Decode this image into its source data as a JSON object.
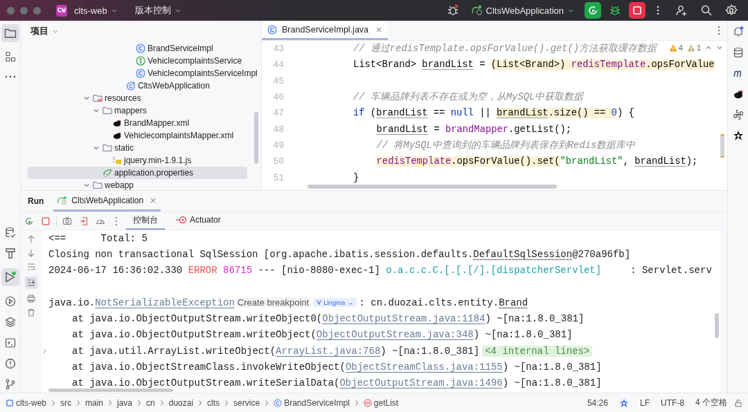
{
  "title_bar": {
    "badge": "CW",
    "project": "clts-web",
    "vcs": "版本控制",
    "run_config": "CltsWebApplication"
  },
  "project_panel": {
    "title": "项目",
    "items_above": [
      {
        "label": "BrandServiceImpl",
        "kind": "class"
      },
      {
        "label": "VehiclecomplaintsService",
        "kind": "interface"
      },
      {
        "label": "VehiclecomplaintsServiceImpl",
        "kind": "class"
      },
      {
        "label": "CltsWebApplication",
        "kind": "app"
      }
    ],
    "tree": [
      {
        "label": "resources",
        "kind": "resfolder",
        "expanded": true,
        "selected": false,
        "children": [
          {
            "label": "mappers",
            "kind": "folder",
            "expanded": true,
            "selected": false,
            "children": [
              {
                "label": "BrandMapper.xml",
                "kind": "mybatis",
                "selected": false
              },
              {
                "label": "VehiclecomplaintsMapper.xml",
                "kind": "mybatis",
                "selected": false
              }
            ]
          },
          {
            "label": "static",
            "kind": "folder",
            "expanded": true,
            "selected": false,
            "children": [
              {
                "label": "jquery.min-1.9.1.js",
                "kind": "js",
                "selected": false
              }
            ]
          },
          {
            "label": "application.properties",
            "kind": "props",
            "selected": true
          }
        ]
      },
      {
        "label": "webapp",
        "kind": "folder",
        "expanded": true,
        "selected": false
      }
    ]
  },
  "editor": {
    "tab": {
      "label": "BrandServiceImpl.java",
      "selected": true
    },
    "warnings": "4",
    "weak_warnings": "1",
    "lines": [
      {
        "number": "43",
        "tokens": [
          {
            "text": "// 通过redisTemplate.opsForValue().get()方法获取缓存数据",
            "kind": "comment",
            "highlighted": false
          }
        ]
      },
      {
        "number": "44",
        "tokens": [
          {
            "text": "List<Brand> ",
            "kind": "plain",
            "highlighted": false
          },
          {
            "text": "brandList",
            "kind": "variable",
            "highlighted": false
          },
          {
            "text": " = ",
            "kind": "plain",
            "highlighted": false
          },
          {
            "text": "(List<Brand>) ",
            "kind": "plain",
            "highlighted": true
          },
          {
            "text": "redisTemplate",
            "kind": "field",
            "highlighted": true
          },
          {
            "text": ".opsForValue",
            "kind": "plain",
            "highlighted": true
          }
        ]
      },
      {
        "number": "45"
      },
      {
        "number": "46",
        "tokens": [
          {
            "text": "// 车辆品牌列表不存在或为空，从MySQL中获取数据",
            "kind": "comment",
            "highlighted": false
          }
        ]
      },
      {
        "number": "47",
        "tokens": [
          {
            "text": "if",
            "kind": "keyword",
            "highlighted": false
          },
          {
            "text": " (",
            "kind": "plain",
            "highlighted": false
          },
          {
            "text": "brandList",
            "kind": "variable",
            "highlighted": false
          },
          {
            "text": " == ",
            "kind": "plain",
            "highlighted": false
          },
          {
            "text": "null",
            "kind": "keyword",
            "highlighted": false
          },
          {
            "text": " || ",
            "kind": "plain",
            "highlighted": false
          },
          {
            "text": "brandList",
            "kind": "variable",
            "highlighted": true
          },
          {
            "text": ".size() == ",
            "kind": "plain",
            "highlighted": true
          },
          {
            "text": "0",
            "kind": "number",
            "highlighted": true
          },
          {
            "text": ") {",
            "kind": "plain",
            "highlighted": false
          }
        ],
        "children": [
          {
            "number": "48",
            "tokens": [
              {
                "text": "brandList",
                "kind": "variable",
                "highlighted": false
              },
              {
                "text": " = ",
                "kind": "plain",
                "highlighted": false
              },
              {
                "text": "brandMapper",
                "kind": "field",
                "highlighted": false
              },
              {
                "text": ".getList();",
                "kind": "plain",
                "highlighted": false
              }
            ]
          },
          {
            "number": "49",
            "tokens": [
              {
                "text": "// 将MySQL中查询到的车辆品牌列表保存到Redis数据库中",
                "kind": "comment",
                "highlighted": false
              }
            ]
          },
          {
            "number": "50",
            "tokens": [
              {
                "text": "redisTemplate",
                "kind": "field",
                "highlighted": true
              },
              {
                "text": ".opsForValue().set(",
                "kind": "plain",
                "highlighted": true
              },
              {
                "text": "\"brandList\"",
                "kind": "string",
                "highlighted": false
              },
              {
                "text": ", ",
                "kind": "plain",
                "highlighted": false
              },
              {
                "text": "brandList",
                "kind": "variable",
                "highlighted": false
              },
              {
                "text": ");",
                "kind": "plain",
                "highlighted": false
              }
            ]
          }
        ]
      },
      {
        "number": "51",
        "tokens": [
          {
            "text": "}",
            "kind": "plain",
            "highlighted": false
          }
        ]
      }
    ]
  },
  "run_panel": {
    "title": "Run",
    "tab": "CltsWebApplication",
    "subtabs": [
      {
        "label": "控制台",
        "kind": "console",
        "selected": true
      },
      {
        "label": "Actuator",
        "kind": "actuator",
        "selected": false
      }
    ],
    "console": [
      {
        "kind": "text",
        "tokens": [
          {
            "text": "<==      Total: 5",
            "kind": "plain"
          }
        ]
      },
      {
        "kind": "text",
        "tokens": [
          {
            "text": "Closing non transactional SqlSession [org.apache.ibatis.session.defaults.",
            "kind": "plain"
          },
          {
            "text": "DefaultSqlSession",
            "kind": "dotted"
          },
          {
            "text": "@270a96fb]",
            "kind": "plain"
          }
        ]
      },
      {
        "kind": "text",
        "tokens": [
          {
            "text": "2024-06-17 16:36:02.330 ",
            "kind": "plain"
          },
          {
            "text": "ERROR",
            "kind": "error"
          },
          {
            "text": "86715",
            "kind": "pid"
          },
          {
            "text": " --- [nio-8080-exec-1] ",
            "kind": "plain"
          },
          {
            "text": "o.a.c.c.C.[.[.[/].[dispatcherServlet]",
            "kind": "logger"
          },
          {
            "text": "     : Servlet.serv",
            "kind": "plain"
          }
        ]
      },
      {
        "kind": "blank"
      },
      {
        "kind": "text",
        "tokens": [
          {
            "text": "java.io.",
            "kind": "plain"
          },
          {
            "text": "NotSerializableException",
            "kind": "link"
          },
          {
            "text": "Create breakpoint",
            "kind": "action"
          },
          {
            "text": "Lingma →",
            "kind": "badge"
          },
          {
            "text": ": cn.duozai.clts.entity.",
            "kind": "plain"
          },
          {
            "text": "Brand",
            "kind": "dotted"
          }
        ]
      },
      {
        "kind": "frame",
        "foldable": false,
        "tokens": [
          {
            "text": "at java.io.ObjectOutputStream.writeObject0(",
            "kind": "plain"
          },
          {
            "text": "ObjectOutputStream.java:1184",
            "kind": "link"
          },
          {
            "text": ") ~[na:1.8.0_381]",
            "kind": "plain"
          }
        ]
      },
      {
        "kind": "frame",
        "foldable": false,
        "tokens": [
          {
            "text": "at java.io.ObjectOutputStream.writeObject(",
            "kind": "plain"
          },
          {
            "text": "ObjectOutputStream.java:348",
            "kind": "link"
          },
          {
            "text": ") ~[na:1.8.0_381]",
            "kind": "plain"
          }
        ]
      },
      {
        "kind": "frame",
        "foldable": true,
        "tokens": [
          {
            "text": "at java.util.ArrayList.writeObject(",
            "kind": "plain"
          },
          {
            "text": "ArrayList.java:768",
            "kind": "link"
          },
          {
            "text": ") ~[na:1.8.0_381]",
            "kind": "plain"
          },
          {
            "text": "<4 internal lines>",
            "kind": "folded"
          }
        ]
      },
      {
        "kind": "frame",
        "foldable": false,
        "tokens": [
          {
            "text": "at java.io.ObjectStreamClass.invokeWriteObject(",
            "kind": "plain"
          },
          {
            "text": "ObjectStreamClass.java:1155",
            "kind": "link"
          },
          {
            "text": ") ~[na:1.8.0_381]",
            "kind": "plain"
          }
        ]
      },
      {
        "kind": "frame",
        "foldable": false,
        "tokens": [
          {
            "text": "at java.io.ObjectOutputStream.writeSerialData(",
            "kind": "plain"
          },
          {
            "text": "ObjectOutputStream.java:1496",
            "kind": "link"
          },
          {
            "text": ") ~[na:1.8.0_381]",
            "kind": "plain"
          }
        ]
      }
    ]
  },
  "status_bar": {
    "breadcrumb": [
      {
        "label": "clts-web",
        "kind": "module"
      },
      {
        "label": "src",
        "kind": "dir"
      },
      {
        "label": "main",
        "kind": "dir"
      },
      {
        "label": "java",
        "kind": "dir"
      },
      {
        "label": "cn",
        "kind": "dir"
      },
      {
        "label": "duozai",
        "kind": "dir"
      },
      {
        "label": "clts",
        "kind": "dir"
      },
      {
        "label": "service",
        "kind": "dir"
      },
      {
        "label": "BrandServiceImpl",
        "kind": "class"
      },
      {
        "label": "getList",
        "kind": "method"
      }
    ],
    "position": "54:26",
    "line_separator": "LF",
    "encoding": "UTF-8",
    "indent": "4 个空格"
  }
}
